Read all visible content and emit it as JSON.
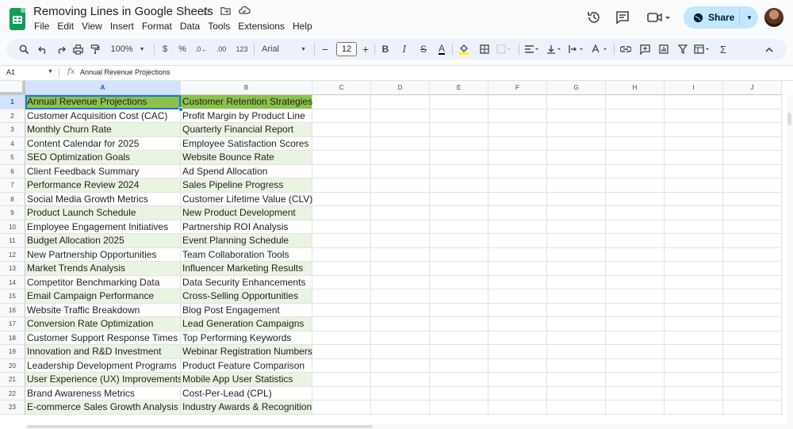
{
  "document": {
    "title": "Removing Lines in Google Sheets",
    "menus": [
      "File",
      "Edit",
      "View",
      "Insert",
      "Format",
      "Data",
      "Tools",
      "Extensions",
      "Help"
    ]
  },
  "share": {
    "label": "Share"
  },
  "toolbar": {
    "zoom": "100%",
    "currency": "$",
    "percent": "%",
    "dec_decrease": ".0←",
    "dec_increase": ".00",
    "number_format": "123",
    "font": "Arial",
    "font_size": "12",
    "bold": "B",
    "italic": "I",
    "text_color": "A"
  },
  "formula_bar": {
    "cell_ref": "A1",
    "fx": "fx",
    "value": "Annual Revenue Projections"
  },
  "sheet": {
    "columns": [
      "A",
      "B",
      "C",
      "D",
      "E",
      "F",
      "G",
      "H",
      "I",
      "J"
    ],
    "row_numbers": [
      "1",
      "2",
      "3",
      "4",
      "5",
      "6",
      "7",
      "8",
      "9",
      "10",
      "11",
      "12",
      "13",
      "14",
      "15",
      "16",
      "17",
      "18",
      "19",
      "20",
      "21",
      "22",
      "23"
    ],
    "header_color": "#8bc34a",
    "band_color": "#eaf4e2",
    "rows": [
      [
        "Annual Revenue Projections",
        "Customer Retention Strategies"
      ],
      [
        "Customer Acquisition Cost (CAC)",
        "Profit Margin by Product Line"
      ],
      [
        "Monthly Churn Rate",
        "Quarterly Financial Report"
      ],
      [
        "Content Calendar for 2025",
        "Employee Satisfaction Scores"
      ],
      [
        "SEO Optimization Goals",
        "Website Bounce Rate"
      ],
      [
        "Client Feedback Summary",
        "Ad Spend Allocation"
      ],
      [
        "Performance Review 2024",
        "Sales Pipeline Progress"
      ],
      [
        "Social Media Growth Metrics",
        "Customer Lifetime Value (CLV)"
      ],
      [
        "Product Launch Schedule",
        "New Product Development"
      ],
      [
        "Employee Engagement Initiatives",
        "Partnership ROI Analysis"
      ],
      [
        "Budget Allocation 2025",
        "Event Planning Schedule"
      ],
      [
        "New Partnership Opportunities",
        "Team Collaboration Tools"
      ],
      [
        "Market Trends Analysis",
        "Influencer Marketing Results"
      ],
      [
        "Competitor Benchmarking Data",
        "Data Security Enhancements"
      ],
      [
        "Email Campaign Performance",
        "Cross-Selling Opportunities"
      ],
      [
        "Website Traffic Breakdown",
        "Blog Post Engagement"
      ],
      [
        "Conversion Rate Optimization",
        "Lead Generation Campaigns"
      ],
      [
        "Customer Support Response Times",
        "Top Performing Keywords"
      ],
      [
        "Innovation and R&D Investment",
        "Webinar Registration Numbers"
      ],
      [
        "Leadership Development Programs",
        "Product Feature Comparison"
      ],
      [
        "User Experience (UX) Improvements",
        "Mobile App User Statistics"
      ],
      [
        "Brand Awareness Metrics",
        "Cost-Per-Lead (CPL)"
      ],
      [
        "E-commerce Sales Growth Analysis",
        "Industry Awards & Recognition"
      ]
    ]
  }
}
